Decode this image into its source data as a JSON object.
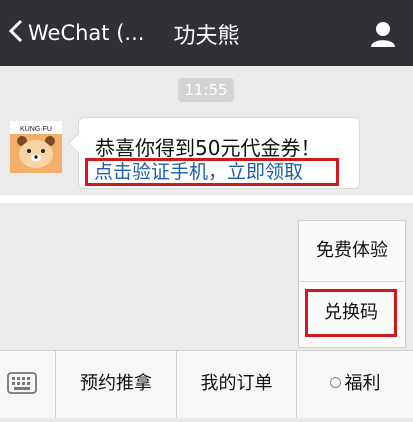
{
  "header": {
    "back_label": "WeChat (...",
    "title": "功夫熊"
  },
  "chat": {
    "time": "11:55",
    "avatar_brand": "KUNG·FU",
    "message": "恭喜你得到50元代金券！",
    "link": "点击验证手机，立即领取"
  },
  "popup_menu": {
    "items": [
      "免费体验",
      "兑换码"
    ]
  },
  "bottom_menu": {
    "tabs": [
      "预约推拿",
      "我的订单",
      "福利"
    ]
  },
  "colors": {
    "header_bg": "#2f3135",
    "link": "#1f5ea8",
    "highlight_border": "#d01a1a",
    "chat_bg": "#ebebeb"
  }
}
